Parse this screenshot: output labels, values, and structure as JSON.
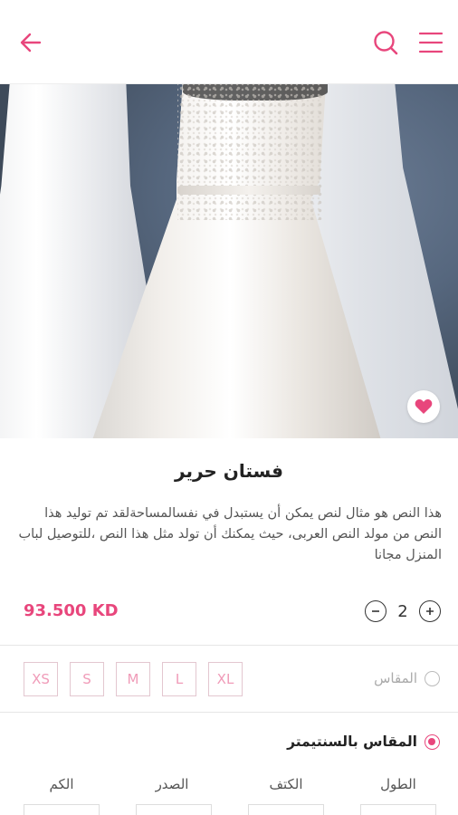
{
  "header": {
    "back_icon": "arrow-left-icon",
    "search_icon": "search-icon",
    "menu_icon": "hamburger-menu-icon",
    "accent_color": "#e8467c"
  },
  "product": {
    "image_alt": "",
    "favorite_icon": "heart-icon",
    "title": "فستان حرير",
    "description": "هذا النص هو مثال لنص يمكن أن يستبدل في نفسالمساحةلقد تم توليد هذا النص من مولد النص العربى، حيث يمكنك أن تولد مثل هذا النص ،للتوصيل لباب المنزل مجانا",
    "price": "93.500 KD",
    "quantity": "2"
  },
  "sizes": {
    "standard_label": "المقاس",
    "options": [
      "XS",
      "S",
      "M",
      "L",
      "XL"
    ]
  },
  "custom_size": {
    "label": "المقاس بالسنتيمتر",
    "selected": true,
    "fields": [
      "الطول",
      "الكتف",
      "الصدر",
      "الكم"
    ]
  }
}
